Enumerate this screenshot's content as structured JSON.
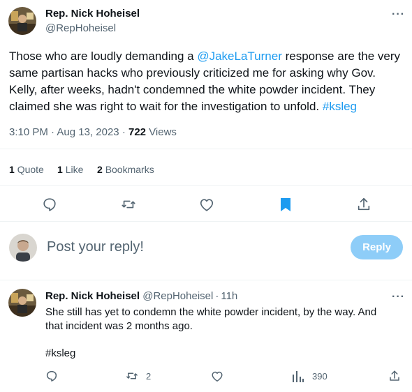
{
  "main_tweet": {
    "author_name": "Rep. Nick Hoheisel",
    "author_handle": "@RepHoheisel",
    "more_label": "···",
    "text_prefix": "Those who are loudly demanding a ",
    "mention": "@JakeLaTurner",
    "text_body": " response are the very same partisan hacks who previously criticized me for asking why Gov. Kelly, after weeks, hadn't condemned the white powder incident. They claimed she was right to wait for the investigation to unfold. ",
    "hashtag": "#ksleg",
    "time": "3:10 PM",
    "date": "Aug 13, 2023",
    "separator": "·",
    "views_count": "722",
    "views_label": "Views",
    "quotes_count": "1",
    "quotes_label": "Quote",
    "likes_count": "1",
    "likes_label": "Like",
    "bookmarks_count": "2",
    "bookmarks_label": "Bookmarks"
  },
  "composer": {
    "placeholder": "Post your reply!",
    "button_label": "Reply"
  },
  "reply_tweet": {
    "author_name": "Rep. Nick Hoheisel",
    "author_handle": "@RepHoheisel",
    "separator": "·",
    "time": "11h",
    "more_label": "···",
    "text_line1": "She still has yet to condemn the white powder incident, by the way. And",
    "text_line2": "that incident was 2 months ago.",
    "hashtag": "#ksleg",
    "retweet_count": "2",
    "views_count": "390"
  },
  "colors": {
    "accent": "#1d9bf0",
    "reply_button_disabled": "#8ecdf8",
    "muted_text": "#536471"
  },
  "icons": [
    "reply-icon",
    "retweet-icon",
    "like-icon",
    "bookmark-icon",
    "share-icon",
    "views-icon",
    "more-icon"
  ]
}
